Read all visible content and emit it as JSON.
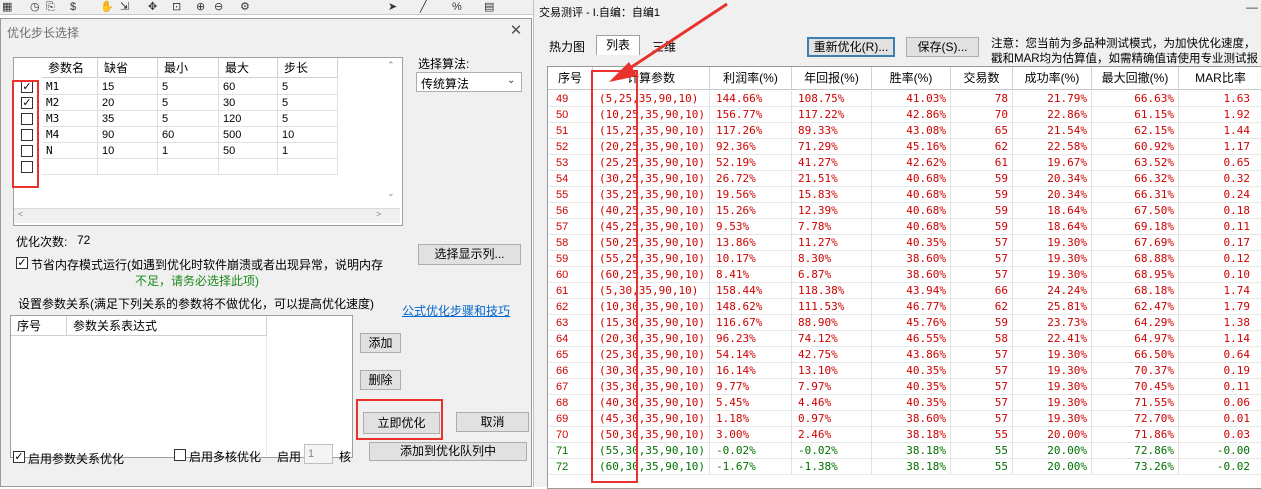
{
  "toolbar": {
    "icons": [
      "grid-icon",
      "clock-icon",
      "copy-icon",
      "dollar-icon",
      "hand-icon",
      "export-icon",
      "move-icon",
      "zoom-fit-icon",
      "zoom-in-icon",
      "zoom-out-icon",
      "settings-icon",
      "cursor-icon",
      "line-icon",
      "percent-icon",
      "table-icon"
    ]
  },
  "dialog": {
    "title": "优化步长选择",
    "param_headers": [
      "参数名",
      "缺省",
      "最小",
      "最大",
      "步长"
    ],
    "params": [
      {
        "checked": true,
        "name": "M1",
        "default": "15",
        "min": "5",
        "max": "60",
        "step": "5"
      },
      {
        "checked": true,
        "name": "M2",
        "default": "20",
        "min": "5",
        "max": "30",
        "step": "5"
      },
      {
        "checked": false,
        "name": "M3",
        "default": "35",
        "min": "5",
        "max": "120",
        "step": "5"
      },
      {
        "checked": false,
        "name": "M4",
        "default": "90",
        "min": "60",
        "max": "500",
        "step": "10"
      },
      {
        "checked": false,
        "name": "N",
        "default": "10",
        "min": "1",
        "max": "50",
        "step": "1"
      },
      {
        "checked": false,
        "name": "",
        "default": "",
        "min": "",
        "max": "",
        "step": ""
      }
    ],
    "algo_label": "选择算法:",
    "algo_value": "传统算法",
    "opt_count_label": "优化次数:",
    "opt_count": "72",
    "select_cols_button": "选择显示列...",
    "memory_mode_label": "节省内存模式运行(如遇到优化时软件崩溃或者出现异常，说明内存",
    "memory_mode_note": "不足，请务必选择此项)",
    "memory_mode_checked": true,
    "relation_label": "设置参数关系(满足下列关系的参数将不做优化，可以提高优化速度)",
    "formula_link": "公式优化步骤和技巧",
    "relation_headers": [
      "序号",
      "参数关系表达式"
    ],
    "add_button": "添加",
    "delete_button": "删除",
    "optimize_button": "立即优化",
    "cancel_button": "取消",
    "enable_relation_label": "启用参数关系优化",
    "enable_relation_checked": true,
    "multicore_label": "启用多核优化",
    "multicore_checked": false,
    "enable_label": "启用",
    "core_count": "1",
    "core_unit": "核",
    "add_queue_button": "添加到优化队列中"
  },
  "result_window": {
    "title": "交易测评 - I.自编：自编1",
    "tabs": [
      "热力图",
      "列表",
      "三维"
    ],
    "reoptimize_button": "重新优化(R)...",
    "save_button": "保存(S)...",
    "note_line1": "注意：您当前为多品种测试模式，为加快优化速度，",
    "note_line2": "戳和MAR均为估算值，如需精确值请使用专业测试报",
    "headers": [
      "序号",
      "计算参数",
      "利润率(%)",
      "年回报(%)",
      "胜率(%)",
      "交易数",
      "成功率(%)",
      "最大回撤(%)",
      "MAR比率"
    ],
    "rows": [
      {
        "id": "49",
        "params": "(5,25,35,90,10)",
        "profit": "144.66%",
        "annual": "108.75%",
        "win": "41.03%",
        "trades": "78",
        "success": "21.79%",
        "dd": "66.63%",
        "mar": "1.63",
        "color": "red"
      },
      {
        "id": "50",
        "params": "(10,25,35,90,10)",
        "profit": "156.77%",
        "annual": "117.22%",
        "win": "42.86%",
        "trades": "70",
        "success": "22.86%",
        "dd": "61.15%",
        "mar": "1.92",
        "color": "red"
      },
      {
        "id": "51",
        "params": "(15,25,35,90,10)",
        "profit": "117.26%",
        "annual": "89.33%",
        "win": "43.08%",
        "trades": "65",
        "success": "21.54%",
        "dd": "62.15%",
        "mar": "1.44",
        "color": "red"
      },
      {
        "id": "52",
        "params": "(20,25,35,90,10)",
        "profit": "92.36%",
        "annual": "71.29%",
        "win": "45.16%",
        "trades": "62",
        "success": "22.58%",
        "dd": "60.92%",
        "mar": "1.17",
        "color": "red"
      },
      {
        "id": "53",
        "params": "(25,25,35,90,10)",
        "profit": "52.19%",
        "annual": "41.27%",
        "win": "42.62%",
        "trades": "61",
        "success": "19.67%",
        "dd": "63.52%",
        "mar": "0.65",
        "color": "red"
      },
      {
        "id": "54",
        "params": "(30,25,35,90,10)",
        "profit": "26.72%",
        "annual": "21.51%",
        "win": "40.68%",
        "trades": "59",
        "success": "20.34%",
        "dd": "66.32%",
        "mar": "0.32",
        "color": "red"
      },
      {
        "id": "55",
        "params": "(35,25,35,90,10)",
        "profit": "19.56%",
        "annual": "15.83%",
        "win": "40.68%",
        "trades": "59",
        "success": "20.34%",
        "dd": "66.31%",
        "mar": "0.24",
        "color": "red"
      },
      {
        "id": "56",
        "params": "(40,25,35,90,10)",
        "profit": "15.26%",
        "annual": "12.39%",
        "win": "40.68%",
        "trades": "59",
        "success": "18.64%",
        "dd": "67.50%",
        "mar": "0.18",
        "color": "red"
      },
      {
        "id": "57",
        "params": "(45,25,35,90,10)",
        "profit": "9.53%",
        "annual": "7.78%",
        "win": "40.68%",
        "trades": "59",
        "success": "18.64%",
        "dd": "69.18%",
        "mar": "0.11",
        "color": "red"
      },
      {
        "id": "58",
        "params": "(50,25,35,90,10)",
        "profit": "13.86%",
        "annual": "11.27%",
        "win": "40.35%",
        "trades": "57",
        "success": "19.30%",
        "dd": "67.69%",
        "mar": "0.17",
        "color": "red"
      },
      {
        "id": "59",
        "params": "(55,25,35,90,10)",
        "profit": "10.17%",
        "annual": "8.30%",
        "win": "38.60%",
        "trades": "57",
        "success": "19.30%",
        "dd": "68.88%",
        "mar": "0.12",
        "color": "red"
      },
      {
        "id": "60",
        "params": "(60,25,35,90,10)",
        "profit": "8.41%",
        "annual": "6.87%",
        "win": "38.60%",
        "trades": "57",
        "success": "19.30%",
        "dd": "68.95%",
        "mar": "0.10",
        "color": "red"
      },
      {
        "id": "61",
        "params": "(5,30,35,90,10)",
        "profit": "158.44%",
        "annual": "118.38%",
        "win": "43.94%",
        "trades": "66",
        "success": "24.24%",
        "dd": "68.18%",
        "mar": "1.74",
        "color": "red"
      },
      {
        "id": "62",
        "params": "(10,30,35,90,10)",
        "profit": "148.62%",
        "annual": "111.53%",
        "win": "46.77%",
        "trades": "62",
        "success": "25.81%",
        "dd": "62.47%",
        "mar": "1.79",
        "color": "red"
      },
      {
        "id": "63",
        "params": "(15,30,35,90,10)",
        "profit": "116.67%",
        "annual": "88.90%",
        "win": "45.76%",
        "trades": "59",
        "success": "23.73%",
        "dd": "64.29%",
        "mar": "1.38",
        "color": "red"
      },
      {
        "id": "64",
        "params": "(20,30,35,90,10)",
        "profit": "96.23%",
        "annual": "74.12%",
        "win": "46.55%",
        "trades": "58",
        "success": "22.41%",
        "dd": "64.97%",
        "mar": "1.14",
        "color": "red"
      },
      {
        "id": "65",
        "params": "(25,30,35,90,10)",
        "profit": "54.14%",
        "annual": "42.75%",
        "win": "43.86%",
        "trades": "57",
        "success": "19.30%",
        "dd": "66.50%",
        "mar": "0.64",
        "color": "red"
      },
      {
        "id": "66",
        "params": "(30,30,35,90,10)",
        "profit": "16.14%",
        "annual": "13.10%",
        "win": "40.35%",
        "trades": "57",
        "success": "19.30%",
        "dd": "70.37%",
        "mar": "0.19",
        "color": "red"
      },
      {
        "id": "67",
        "params": "(35,30,35,90,10)",
        "profit": "9.77%",
        "annual": "7.97%",
        "win": "40.35%",
        "trades": "57",
        "success": "19.30%",
        "dd": "70.45%",
        "mar": "0.11",
        "color": "red"
      },
      {
        "id": "68",
        "params": "(40,30,35,90,10)",
        "profit": "5.45%",
        "annual": "4.46%",
        "win": "40.35%",
        "trades": "57",
        "success": "19.30%",
        "dd": "71.55%",
        "mar": "0.06",
        "color": "red"
      },
      {
        "id": "69",
        "params": "(45,30,35,90,10)",
        "profit": "1.18%",
        "annual": "0.97%",
        "win": "38.60%",
        "trades": "57",
        "success": "19.30%",
        "dd": "72.70%",
        "mar": "0.01",
        "color": "red"
      },
      {
        "id": "70",
        "params": "(50,30,35,90,10)",
        "profit": "3.00%",
        "annual": "2.46%",
        "win": "38.18%",
        "trades": "55",
        "success": "20.00%",
        "dd": "71.86%",
        "mar": "0.03",
        "color": "red"
      },
      {
        "id": "71",
        "params": "(55,30,35,90,10)",
        "profit": "-0.02%",
        "annual": "-0.02%",
        "win": "38.18%",
        "trades": "55",
        "success": "20.00%",
        "dd": "72.86%",
        "mar": "-0.00",
        "color": "green"
      },
      {
        "id": "72",
        "params": "(60,30,35,90,10)",
        "profit": "-1.67%",
        "annual": "-1.38%",
        "win": "38.18%",
        "trades": "55",
        "success": "20.00%",
        "dd": "73.26%",
        "mar": "-0.02",
        "color": "green"
      }
    ]
  },
  "colors": {
    "highlight": "#e8322b",
    "positive": "#d00000",
    "negative": "#007000",
    "link": "#0066cc"
  }
}
